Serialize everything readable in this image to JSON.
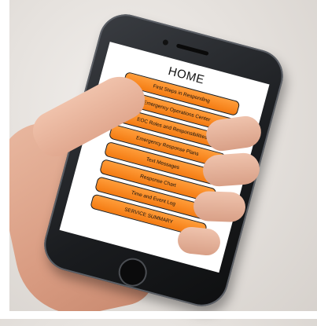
{
  "app": {
    "title": "HOME"
  },
  "menu": [
    {
      "label": "First Steps in Responding"
    },
    {
      "label": "Emergency Operations Center"
    },
    {
      "label": "EOC Roles and Responsibilities"
    },
    {
      "label": "Emergency Response Plans"
    },
    {
      "label": "Text Messages"
    },
    {
      "label": "Response Chart"
    },
    {
      "label": "Time and Event Log"
    },
    {
      "label": "SERVICE SUMMARY"
    }
  ],
  "colors": {
    "button_fill": "#f47b12",
    "button_border": "#1a1a1a",
    "screen_background": "#ffffff",
    "phone_body": "#1a1c1f"
  }
}
